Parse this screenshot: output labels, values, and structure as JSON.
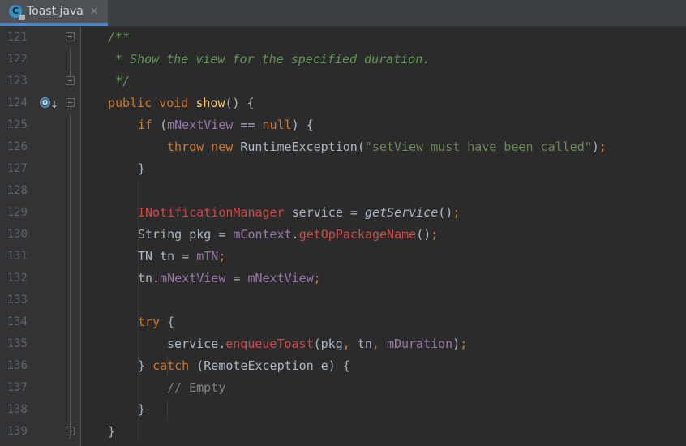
{
  "tab": {
    "title": "Toast.java",
    "close": "✕",
    "file_icon": "class-file-icon",
    "file_icon_letter": "C"
  },
  "colors": {
    "background": "#2b2b2b",
    "keyword": "#cc7832",
    "doc_comment": "#629755",
    "method": "#ffc66d",
    "field": "#9876aa",
    "string": "#6a8759",
    "error": "#cb4a4a"
  },
  "line_numbers": [
    "121",
    "122",
    "123",
    "124",
    "125",
    "126",
    "127",
    "128",
    "129",
    "130",
    "131",
    "132",
    "133",
    "134",
    "135",
    "136",
    "137",
    "138",
    "139"
  ],
  "gutter_marker": {
    "icon": "override-icon",
    "letter": "O",
    "arrow": "↓"
  },
  "code": {
    "l121": "/**",
    "l122": "* Show the view for the specified duration.",
    "l123": "*/",
    "l124": {
      "public": "public",
      "void": "void",
      "name": "show",
      "rest": "() {"
    },
    "l125": {
      "if": "if",
      "open": " (",
      "field": "mNextView",
      "op": " == ",
      "null": "null",
      "close": ") {"
    },
    "l126": {
      "throw": "throw",
      "new": "new",
      "cls": "RuntimeException",
      "po": "(",
      "str": "\"setView must have been called\"",
      "pc": ")",
      "semi": ";"
    },
    "l127": "}",
    "l129": {
      "type": "INotificationManager",
      "rest": " service = ",
      "call": "getService",
      "parens": "()",
      "semi": ";"
    },
    "l130": {
      "pre": "String pkg = ",
      "field": "mContext",
      "dot": ".",
      "call": "getOpPackageName",
      "parens": "()",
      "semi": ";"
    },
    "l131": {
      "pre": "TN tn = ",
      "field": "mTN",
      "semi": ";"
    },
    "l132": {
      "pre": "tn.",
      "field": "mNextView",
      "eq": " = ",
      "field2": "mNextView",
      "semi": ";"
    },
    "l134": {
      "try": "try",
      "rest": " {"
    },
    "l135": {
      "pre": "service.",
      "call": "enqueueToast",
      "args1": "(pkg",
      "c1": ",",
      "args2": " tn",
      "c2": ",",
      "sp": " ",
      "field": "mDuration",
      "pc": ")",
      "semi": ";"
    },
    "l136": {
      "brace": "} ",
      "catch": "catch",
      "rest": " (RemoteException e) {"
    },
    "l137": "// Empty",
    "l138": "}",
    "l139": "}"
  }
}
